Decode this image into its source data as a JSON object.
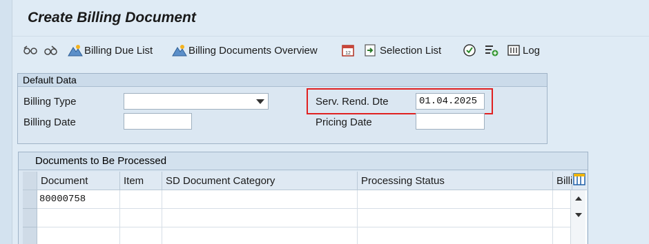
{
  "window": {
    "title": "Create Billing Document"
  },
  "toolbar": {
    "billing_due_list": "Billing Due List",
    "billing_docs_overview": "Billing Documents Overview",
    "selection_list": "Selection List",
    "log": "Log"
  },
  "default_data": {
    "title": "Default Data",
    "billing_type_label": "Billing Type",
    "billing_type_value": "",
    "billing_date_label": "Billing Date",
    "billing_date_value": "",
    "serv_rend_dte_label": "Serv. Rend. Dte",
    "serv_rend_dte_value": "01.04.2025",
    "pricing_date_label": "Pricing Date",
    "pricing_date_value": ""
  },
  "documents": {
    "title": "Documents to Be Processed",
    "columns": [
      "Document",
      "Item",
      "SD Document Category",
      "Processing Status",
      "Billi"
    ],
    "rows": [
      [
        "80000758",
        "",
        "",
        "",
        ""
      ],
      [
        "",
        "",
        "",
        "",
        ""
      ],
      [
        "",
        "",
        "",
        "",
        ""
      ]
    ]
  },
  "colors": {
    "highlight": "#e02020",
    "background": "#dfebf5"
  }
}
